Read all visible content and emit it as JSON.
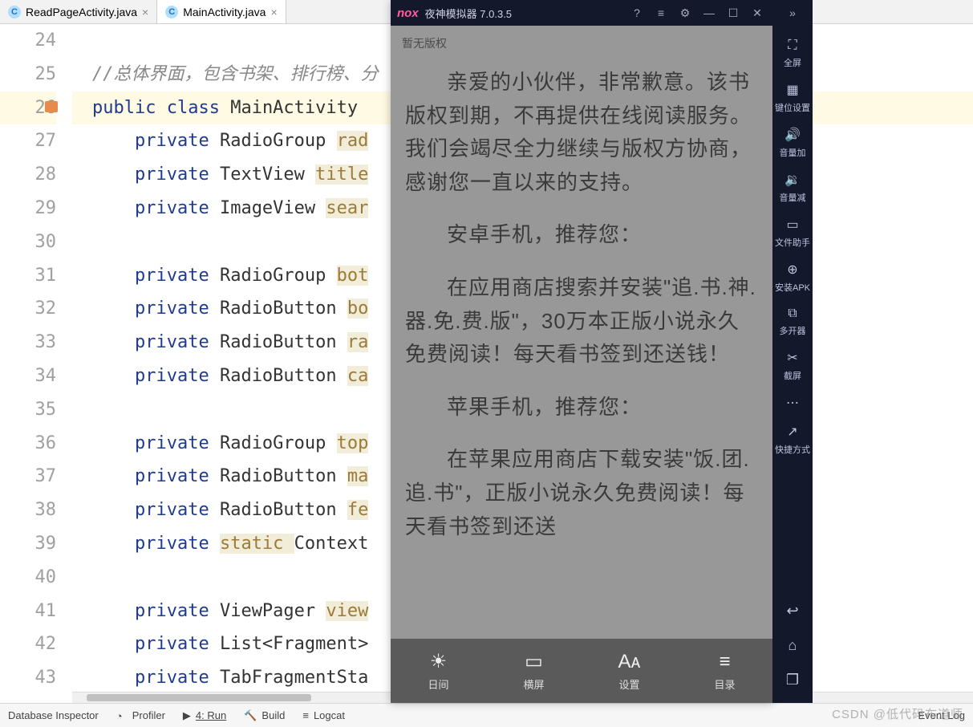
{
  "tabs": {
    "inactive": "ReadPageActivity.java",
    "active": "MainActivity.java"
  },
  "gutter": {
    "start": 24,
    "lines": [
      "24",
      "25",
      "26",
      "27",
      "28",
      "29",
      "30",
      "31",
      "32",
      "33",
      "34",
      "35",
      "36",
      "37",
      "38",
      "39",
      "40",
      "41",
      "42",
      "43"
    ]
  },
  "code": {
    "l24": "",
    "l25_comment": "//总体界面，包含书架、排行榜、分",
    "l26_a": "public ",
    "l26_b": "class ",
    "l26_c": "MainActivity ",
    "l27_a": "private ",
    "l27_b": "RadioGroup ",
    "l27_c": "rad",
    "l28_a": "private ",
    "l28_b": "TextView ",
    "l28_c": "title",
    "l29_a": "private ",
    "l29_b": "ImageView ",
    "l29_c": "sear",
    "l31_a": "private ",
    "l31_b": "RadioGroup ",
    "l31_c": "bot",
    "l32_a": "private ",
    "l32_b": "RadioButton ",
    "l32_c": "bo",
    "l33_a": "private ",
    "l33_b": "RadioButton ",
    "l33_c": "ra",
    "l34_a": "private ",
    "l34_b": "RadioButton ",
    "l34_c": "ca",
    "l36_a": "private ",
    "l36_b": "RadioGroup ",
    "l36_c": "top",
    "l37_a": "private ",
    "l37_b": "RadioButton ",
    "l37_c": "ma",
    "l38_a": "private ",
    "l38_b": "RadioButton ",
    "l38_c": "fe",
    "l39_a": "private ",
    "l39_b": "static ",
    "l39_c": "Context",
    "l41_a": "private ",
    "l41_b": "ViewPager ",
    "l41_c": "view",
    "l42_a": "private ",
    "l42_b": "List<Fragment>",
    "l43_a": "private ",
    "l43_b": "TabFragmentSta"
  },
  "emulator": {
    "brand": "nox",
    "title": "夜神模拟器 7.0.3.5",
    "small": "暂无版权",
    "para1": "亲爱的小伙伴，非常歉意。该书版权到期，不再提供在线阅读服务。我们会竭尽全力继续与版权方协商，感谢您一直以来的支持。",
    "para2": "安卓手机，推荐您：",
    "para3": "在应用商店搜索并安装\"追.书.神.器.免.费.版\"，30万本正版小说永久免费阅读！每天看书签到还送钱！",
    "para4": "苹果手机，推荐您：",
    "para5": "在苹果应用商店下载安装\"饭.团.追.书\"，正版小说永久免费阅读！每天看书签到还送",
    "bottom": {
      "b1": "日间",
      "b2": "横屏",
      "b3": "设置",
      "b4": "目录"
    }
  },
  "sidebar": {
    "s1": "全屏",
    "s2": "键位设置",
    "s3": "音量加",
    "s4": "音量减",
    "s5": "文件助手",
    "s6": "安装APK",
    "s7": "多开器",
    "s8": "截屏",
    "s9": "快捷方式"
  },
  "status": {
    "db": "Database Inspector",
    "profiler": "Profiler",
    "run": "4: Run",
    "build": "Build",
    "logcat": "Logcat",
    "eventlog": "Event Log"
  },
  "watermark": "CSDN @低代码布道师"
}
